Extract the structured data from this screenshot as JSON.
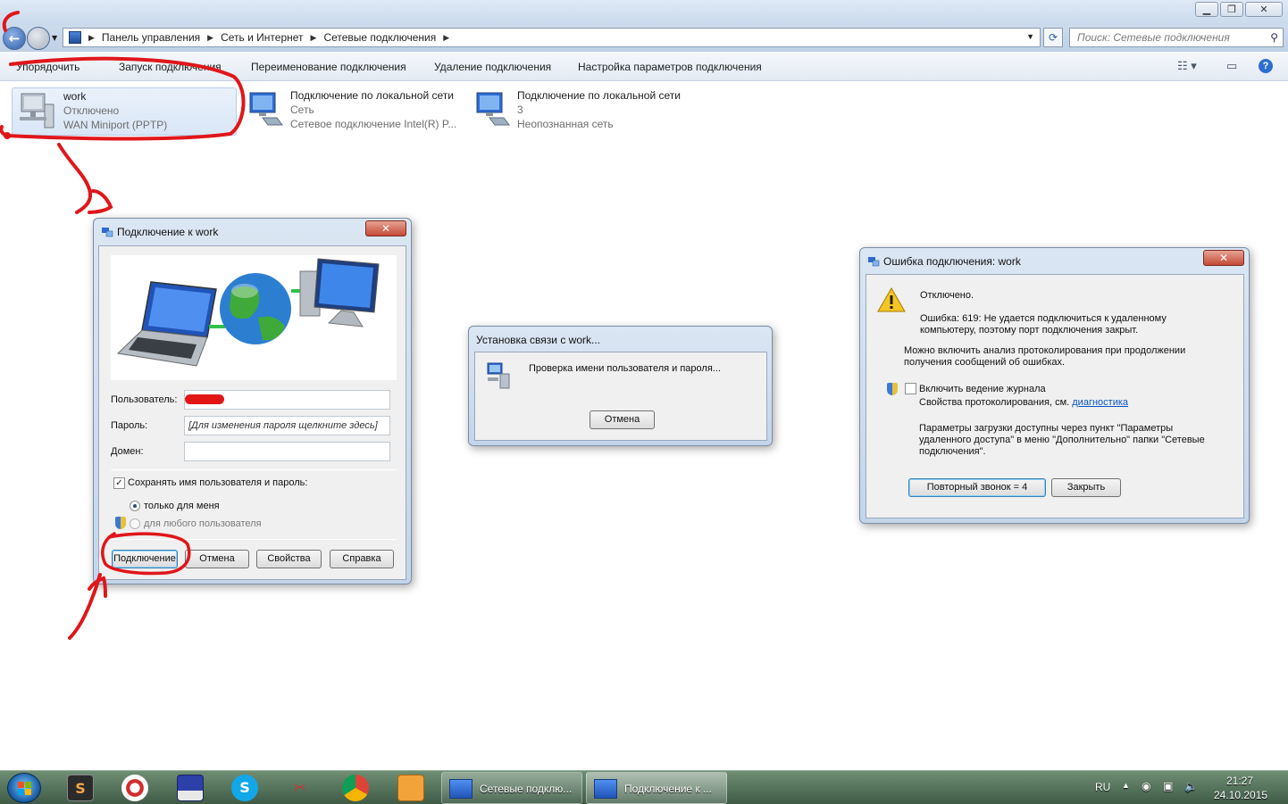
{
  "explorer": {
    "back_glyph": "←",
    "breadcrumb": [
      "Панель управления",
      "Сеть и Интернет",
      "Сетевые подключения"
    ],
    "search_placeholder": "Поиск: Сетевые подключения",
    "toolbar": {
      "organize": "Упорядочить",
      "start_connection": "Запуск подключения",
      "rename": "Переименование подключения",
      "delete": "Удаление подключения",
      "settings": "Настройка параметров подключения"
    },
    "connections": [
      {
        "name": "work",
        "status": "Отключено",
        "device": "WAN Miniport (PPTP)"
      },
      {
        "name": "Подключение по локальной сети",
        "status": "Сеть",
        "device": "Сетевое подключение Intel(R) P..."
      },
      {
        "name": "Подключение по локальной сети",
        "status": "3",
        "device": "Неопознанная сеть"
      }
    ]
  },
  "connect_dialog": {
    "title": "Подключение к work",
    "user_label": "Пользователь:",
    "password_label": "Пароль:",
    "password_placeholder": "[Для изменения пароля щелкните здесь]",
    "domain_label": "Домен:",
    "save_label": "Сохранять имя пользователя и пароль:",
    "only_me": "только для меня",
    "any_user": "для любого пользователя",
    "buttons": {
      "connect": "Подключение",
      "cancel": "Отмена",
      "properties": "Свойства",
      "help": "Справка"
    }
  },
  "progress_dialog": {
    "title": "Установка связи с work...",
    "message": "Проверка имени пользователя и пароля...",
    "cancel": "Отмена"
  },
  "error_dialog": {
    "title": "Ошибка подключения: work",
    "status": "Отключено.",
    "error_line1": "Ошибка: 619: Не удается подключиться к удаленному",
    "error_line2": "компьютеру, поэтому порт подключения закрыт.",
    "log_hint1": "Можно включить анализ протоколирования при продолжении",
    "log_hint2": "получения сообщений об ошибках.",
    "enable_log": "Включить ведение журнала",
    "log_props": "Свойства протоколирования, см.",
    "diag_link": "диагностика",
    "params1": "Параметры загрузки доступны через пункт \"Параметры",
    "params2": "удаленного доступа\" в меню \"Дополнительно\" папки \"Сетевые",
    "params3": "подключения\".",
    "redial": "Повторный звонок = 4",
    "close": "Закрыть"
  },
  "taskbar": {
    "pinned_glyphs": {
      "sublime": "S",
      "skype": "S"
    },
    "tasks": [
      "Сетевые подклю...",
      "Подключение к ..."
    ],
    "lang": "RU",
    "time": "21:27",
    "date": "24.10.2015"
  },
  "colors": {
    "annotation_red": "#e0161a",
    "link": "#0a55c4",
    "dialog_frame": "#c4d5ea",
    "close_button": "#c34a36"
  }
}
